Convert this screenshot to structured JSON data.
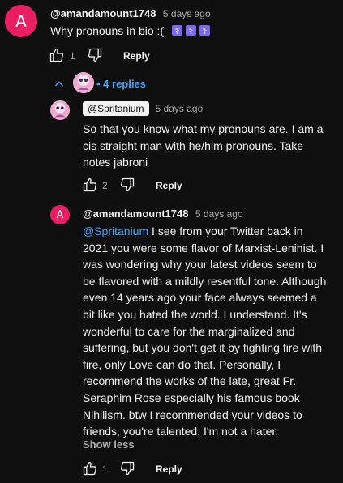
{
  "top_comment": {
    "avatar_letter": "A",
    "author": "@amandamount1748",
    "time": "5 days ago",
    "text": "Why pronouns in bio :(",
    "emojis": [
      "gender-symbol-emoji",
      "gender-symbol-emoji",
      "gender-symbol-emoji"
    ],
    "like_count": "1",
    "reply_label": "Reply"
  },
  "replies_toggle": {
    "label": "• 4 replies"
  },
  "reply1": {
    "author": "@Spritanium",
    "time": "5 days ago",
    "text": "So that you know what my pronouns are. I am a cis straight man with he/him pronouns. Take notes jabroni",
    "like_count": "2",
    "reply_label": "Reply"
  },
  "reply2": {
    "avatar_letter": "A",
    "author": "@amandamount1748",
    "time": "5 days ago",
    "mention": "@Spritanium",
    "text": " I see from your Twitter back in 2021 you were some flavor of Marxist-Leninist. I was wondering why your latest videos seem to be flavored with a mildly resentful tone. Although even 14 years ago your face always seemed a bit like you hated the world. I understand. It's wonderful to care for the marginalized and suffering, but you don't get it by fighting fire with fire, only Love can do that. Personally, I recommend the works of the late, great Fr. Seraphim Rose especially his famous book Nihilism. btw I recommended your videos to friends, you're talented, I'm not a hater.",
    "show_less": "Show less",
    "like_count": "1",
    "reply_label": "Reply"
  },
  "colors": {
    "background": "#0f0f0f",
    "accent_blue": "#3ea6ff",
    "avatar_pink": "#e91e63"
  }
}
